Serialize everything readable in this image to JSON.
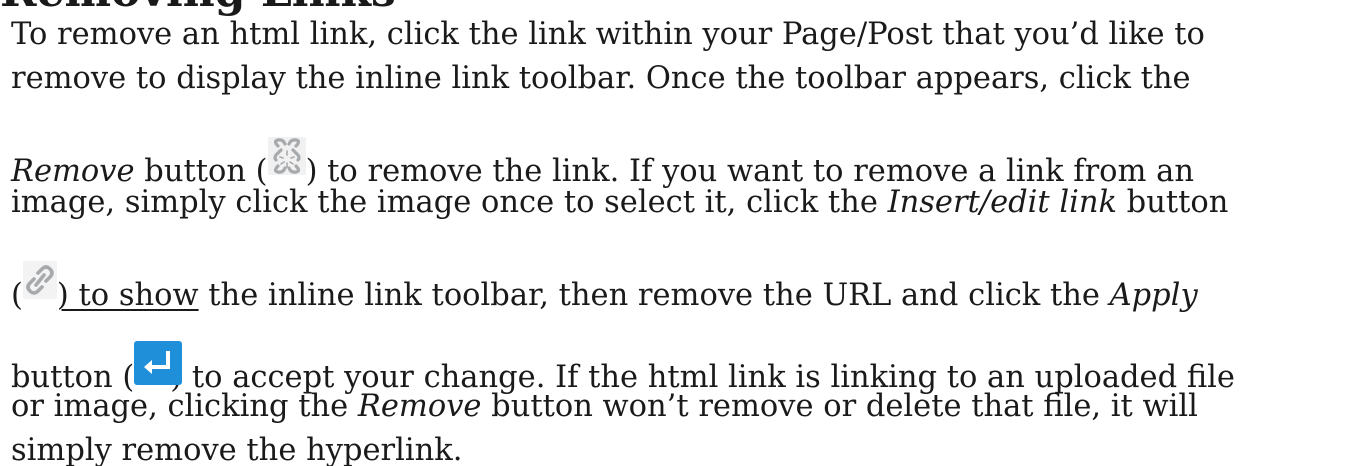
{
  "heading_fragment": "Removing Links",
  "paragraph": {
    "line1": "To remove an html link, click the link within your Page/Post that you’d like to",
    "line2": "remove to display the inline link toolbar. Once the toolbar appears, click the",
    "line3_term": "Remove",
    "line3_a": " button (",
    "line3_b": ") to remove the link. If you want to remove a link from an",
    "line4_a": "image, simply click the image once to select it, click the ",
    "line4_term": "Insert/edit link",
    "line4_b": " button",
    "line5_a": "(",
    "line5_underlined": ") to show",
    "line5_b": " the inline link toolbar, then remove the URL and click the ",
    "line5_term": "Apply",
    "line6_a": "button (",
    "line6_b": ") to accept your change. If the html link is linking to an uploaded file",
    "line7_a": "or image, clicking the ",
    "line7_term": "Remove",
    "line7_b": " button won’t remove or delete that file, it will",
    "line8": "simply remove the hyperlink."
  },
  "icons": {
    "remove": "unlink-icon",
    "insert_edit_link": "chain-link-icon",
    "apply": "enter-return-icon"
  },
  "colors": {
    "text": "#1a1a1a",
    "apply_button": "#1f8fd9",
    "icon_gray": "#a7aaad"
  }
}
